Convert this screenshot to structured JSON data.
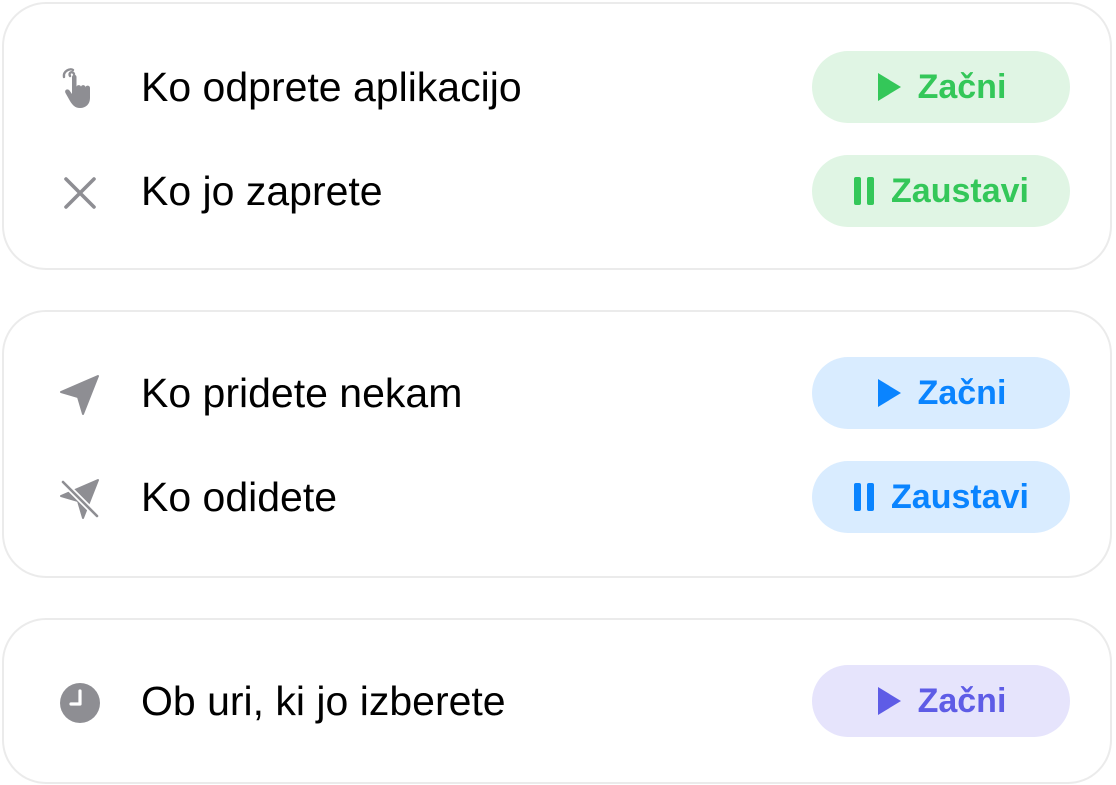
{
  "sections": [
    {
      "rows": [
        {
          "icon": "hand-tap-icon",
          "label": "Ko odprete aplikacijo",
          "button": {
            "icon": "play-icon",
            "label": "Začni"
          }
        },
        {
          "icon": "close-icon",
          "label": "Ko jo zaprete",
          "button": {
            "icon": "pause-icon",
            "label": "Zaustavi"
          }
        }
      ],
      "accent": "#34c759",
      "pill_bg": "#e0f5e4"
    },
    {
      "rows": [
        {
          "icon": "location-arrow-icon",
          "label": "Ko pridete nekam",
          "button": {
            "icon": "play-icon",
            "label": "Začni"
          }
        },
        {
          "icon": "location-slash-icon",
          "label": "Ko odidete",
          "button": {
            "icon": "pause-icon",
            "label": "Zaustavi"
          }
        }
      ],
      "accent": "#0a84ff",
      "pill_bg": "#d9ecff"
    },
    {
      "rows": [
        {
          "icon": "clock-icon",
          "label": "Ob uri, ki jo izberete",
          "button": {
            "icon": "play-icon",
            "label": "Začni"
          }
        }
      ],
      "accent": "#5e5ce6",
      "pill_bg": "#e6e4fc"
    }
  ],
  "icon_color": "#8e8e93"
}
